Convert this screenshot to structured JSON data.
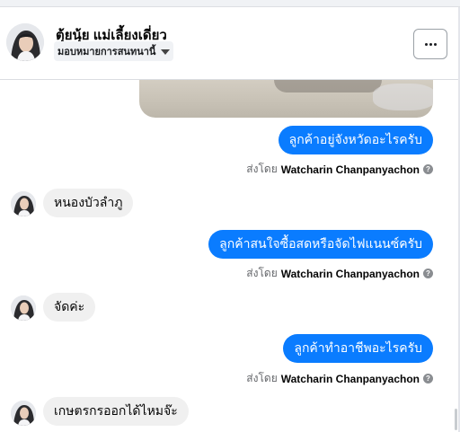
{
  "contact": {
    "name": "ตุ้ยนุ้ย แม่เลี้ยงเดี่ยว",
    "assign_label": "มอบหมายการสนทนานี้"
  },
  "sender": {
    "prefix": "ส่งโดย",
    "name": "Watcharin Chanpanyachon"
  },
  "messages": [
    {
      "direction": "outgoing",
      "text": "ลูกค้าอยู่จังหวัดอะไรครับ"
    },
    {
      "direction": "incoming",
      "text": "หนองบัวลำภู"
    },
    {
      "direction": "outgoing",
      "text": "ลูกค้าสนใจซื้อสดหรือจัดไฟแนนซ์ครับ"
    },
    {
      "direction": "incoming",
      "text": "จัดค่ะ"
    },
    {
      "direction": "outgoing",
      "text": "ลูกค้าทำอาชีพอะไรครับ"
    },
    {
      "direction": "incoming",
      "text": "เกษตรกรออกได้ไหมจ๊ะ"
    }
  ],
  "icons": {
    "more": "more-horizontal-icon",
    "help": "question-circle-icon",
    "caret": "caret-down-icon"
  },
  "colors": {
    "outgoing_bubble": "#0a7cff",
    "incoming_bubble": "#f0f0f0"
  }
}
